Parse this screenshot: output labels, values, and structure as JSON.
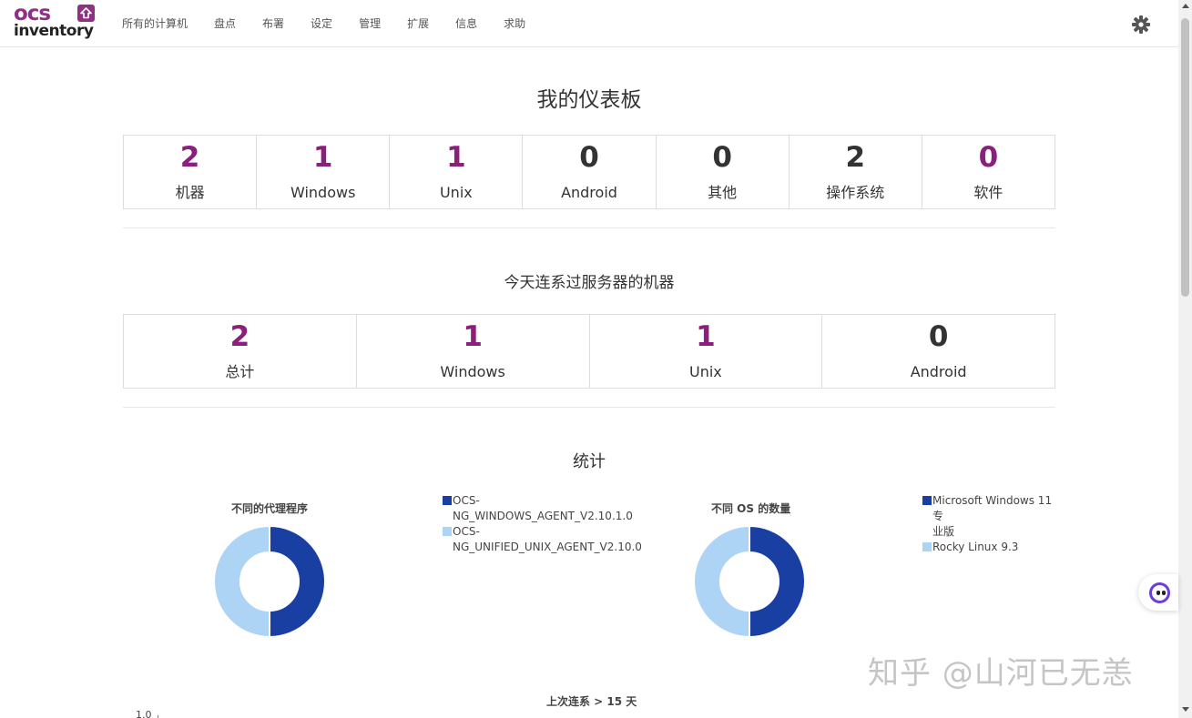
{
  "nav": {
    "logo_top": "ocs",
    "logo_bottom": "inventory",
    "items": [
      "所有的计算机",
      "盘点",
      "布署",
      "设定",
      "管理",
      "扩展",
      "信息",
      "求助"
    ]
  },
  "dashboard": {
    "title": "我的仪表板",
    "stats": [
      {
        "value": "2",
        "label": "机器",
        "color": "#8a1f7c"
      },
      {
        "value": "1",
        "label": "Windows",
        "color": "#8a1f7c"
      },
      {
        "value": "1",
        "label": "Unix",
        "color": "#8a1f7c"
      },
      {
        "value": "0",
        "label": "Android",
        "color": "#333333"
      },
      {
        "value": "0",
        "label": "其他",
        "color": "#333333"
      },
      {
        "value": "2",
        "label": "操作系统",
        "color": "#333333"
      },
      {
        "value": "0",
        "label": "软件",
        "color": "#8a1f7c"
      }
    ]
  },
  "today": {
    "title": "今天连系过服务器的机器",
    "stats": [
      {
        "value": "2",
        "label": "总计",
        "color": "#8a1f7c"
      },
      {
        "value": "1",
        "label": "Windows",
        "color": "#8a1f7c"
      },
      {
        "value": "1",
        "label": "Unix",
        "color": "#8a1f7c"
      },
      {
        "value": "0",
        "label": "Android",
        "color": "#333333"
      }
    ]
  },
  "stats_section": {
    "title": "统计",
    "bottom_chart_title": "上次连系 > 15 天",
    "bottom_axis_label": "1.0"
  },
  "chart_data": [
    {
      "type": "pie",
      "title": "不同的代理程序",
      "labels": [
        "OCS-NG_WINDOWS_AGENT_V2.10.1.0",
        "OCS-NG_UNIFIED_UNIX_AGENT_V2.10.0"
      ],
      "legend_lines": [
        [
          "OCS-",
          "NG_WINDOWS_AGENT_V2.10.1.0"
        ],
        [
          "OCS-",
          "NG_UNIFIED_UNIX_AGENT_V2.10.0"
        ]
      ],
      "values": [
        1,
        1
      ],
      "colors": [
        "#1a3fa3",
        "#aed4f5"
      ],
      "legend_position": "right"
    },
    {
      "type": "pie",
      "title": "不同 OS 的数量",
      "labels": [
        "Microsoft Windows 11 专业版",
        "Rocky Linux 9.3"
      ],
      "legend_lines": [
        [
          "Microsoft Windows 11 专",
          "业版"
        ],
        [
          "Rocky Linux 9.3"
        ]
      ],
      "values": [
        1,
        1
      ],
      "colors": [
        "#1a3fa3",
        "#aed4f5"
      ],
      "legend_position": "right"
    }
  ],
  "watermark": "知乎 @山河已无恙"
}
